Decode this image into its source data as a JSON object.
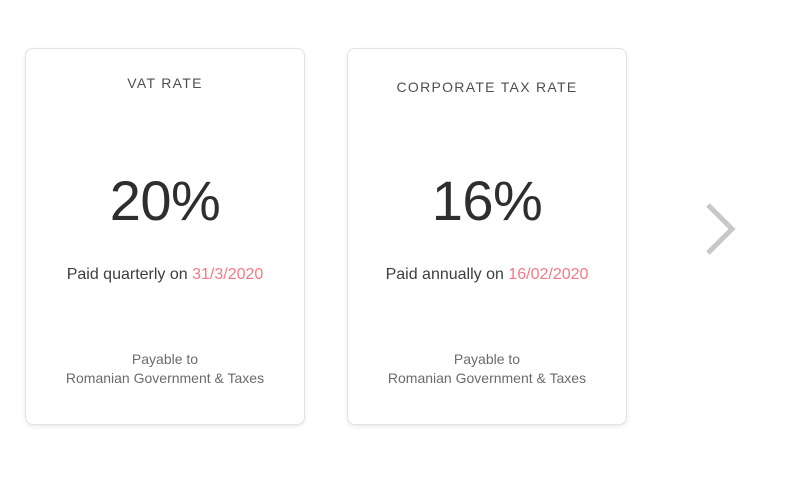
{
  "cards": [
    {
      "title": "VAT RATE",
      "rate": "20%",
      "paid_prefix": "Paid quarterly on ",
      "paid_date": "31/3/2020",
      "payable_line1": "Payable to",
      "payable_line2": "Romanian Government & Taxes"
    },
    {
      "title": "CORPORATE TAX RATE",
      "rate": "16%",
      "paid_prefix": "Paid annually on ",
      "paid_date": "16/02/2020",
      "payable_line1": "Payable to",
      "payable_line2": "Romanian Government & Taxes"
    }
  ],
  "navigation": {
    "next_icon": "chevron-right-icon"
  },
  "colors": {
    "accent_date": "#f07b86",
    "text_primary": "#2e2e2e",
    "text_muted": "#6b6b6b",
    "arrow": "#c8c8c8"
  }
}
